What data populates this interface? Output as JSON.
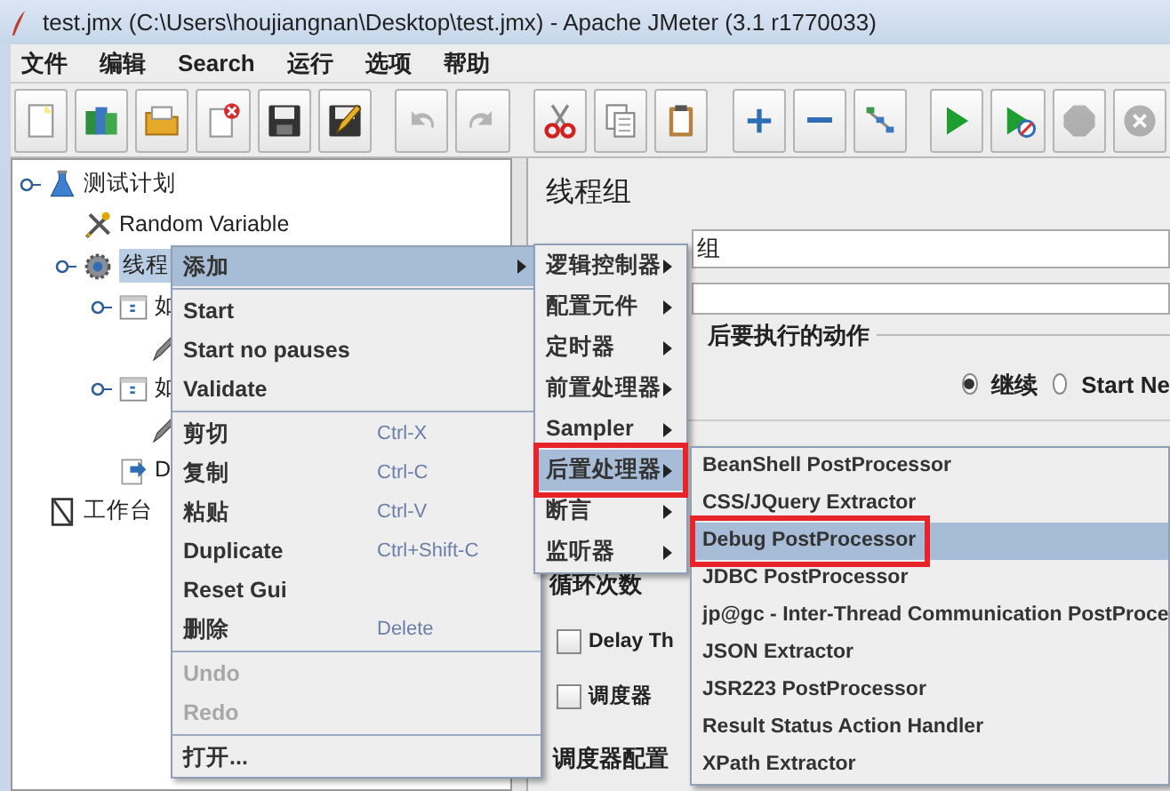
{
  "window": {
    "title": "test.jmx (C:\\Users\\houjiangnan\\Desktop\\test.jmx) - Apache JMeter (3.1 r1770033)"
  },
  "menubar": [
    "文件",
    "编辑",
    "Search",
    "运行",
    "选项",
    "帮助"
  ],
  "toolbar": [
    {
      "kind": "new",
      "disabled": false
    },
    {
      "kind": "templates",
      "disabled": false
    },
    {
      "kind": "open",
      "disabled": false
    },
    {
      "kind": "close",
      "disabled": false
    },
    {
      "kind": "save",
      "disabled": false
    },
    {
      "kind": "saveas",
      "disabled": false
    },
    {
      "kind": "gap"
    },
    {
      "kind": "undo",
      "disabled": true
    },
    {
      "kind": "redo",
      "disabled": true
    },
    {
      "kind": "gap"
    },
    {
      "kind": "cut",
      "disabled": false
    },
    {
      "kind": "copy",
      "disabled": false
    },
    {
      "kind": "paste",
      "disabled": false
    },
    {
      "kind": "gap"
    },
    {
      "kind": "expand",
      "disabled": false
    },
    {
      "kind": "collapse",
      "disabled": false
    },
    {
      "kind": "toggle",
      "disabled": false
    },
    {
      "kind": "gap"
    },
    {
      "kind": "start",
      "disabled": false
    },
    {
      "kind": "startnp",
      "disabled": false
    },
    {
      "kind": "stop",
      "disabled": true
    },
    {
      "kind": "shutdown",
      "disabled": true
    }
  ],
  "tree": [
    {
      "label": "测试计划",
      "kind": "plan",
      "selected": false,
      "expanded": true,
      "children": [
        {
          "label": "Random Variable",
          "kind": "config",
          "selected": false
        },
        {
          "label": "线程",
          "kind": "threadgroup",
          "selected": true,
          "expanded": true,
          "children": [
            {
              "label": "如",
              "kind": "controller",
              "selected": false,
              "expanded": true,
              "children": [
                {
                  "kind": "sampler",
                  "selected": false
                }
              ]
            },
            {
              "label": "如",
              "kind": "controller",
              "selected": false,
              "expanded": true,
              "children": [
                {
                  "kind": "sampler",
                  "selected": false
                }
              ]
            },
            {
              "label": "D",
              "kind": "debug",
              "selected": false
            }
          ]
        }
      ]
    },
    {
      "label": "工作台",
      "kind": "workbench",
      "selected": false
    }
  ],
  "panel": {
    "title": "线程组",
    "name_value": "组",
    "group_legend": "后要执行的动作",
    "radios": [
      {
        "label": "继续",
        "selected": true
      },
      {
        "label": "Start Ne",
        "selected": false
      }
    ],
    "loop_label": "循环次数",
    "checkboxes": [
      {
        "label": "Delay Th",
        "checked": false
      },
      {
        "label": "调度器",
        "checked": false
      }
    ],
    "scheduler_legend": "调度器配置"
  },
  "context_menu": {
    "items": [
      {
        "kind": "item",
        "label": "添加",
        "submenu": true,
        "selected": true,
        "disabled": false
      },
      {
        "kind": "separator"
      },
      {
        "kind": "item",
        "label": "Start",
        "submenu": false,
        "selected": false,
        "disabled": false
      },
      {
        "kind": "item",
        "label": "Start no pauses",
        "submenu": false,
        "selected": false,
        "disabled": false
      },
      {
        "kind": "item",
        "label": "Validate",
        "submenu": false,
        "selected": false,
        "disabled": false
      },
      {
        "kind": "separator"
      },
      {
        "kind": "item",
        "label": "剪切",
        "shortcut": "Ctrl-X",
        "submenu": false,
        "selected": false,
        "disabled": false
      },
      {
        "kind": "item",
        "label": "复制",
        "shortcut": "Ctrl-C",
        "submenu": false,
        "selected": false,
        "disabled": false
      },
      {
        "kind": "item",
        "label": "粘贴",
        "shortcut": "Ctrl-V",
        "submenu": false,
        "selected": false,
        "disabled": false
      },
      {
        "kind": "item",
        "label": "Duplicate",
        "shortcut": "Ctrl+Shift-C",
        "submenu": false,
        "selected": false,
        "disabled": false
      },
      {
        "kind": "item",
        "label": "Reset Gui",
        "submenu": false,
        "selected": false,
        "disabled": false
      },
      {
        "kind": "item",
        "label": "删除",
        "shortcut": "Delete",
        "submenu": false,
        "selected": false,
        "disabled": false
      },
      {
        "kind": "separator"
      },
      {
        "kind": "item",
        "label": "Undo",
        "submenu": false,
        "selected": false,
        "disabled": true
      },
      {
        "kind": "item",
        "label": "Redo",
        "submenu": false,
        "selected": false,
        "disabled": true
      },
      {
        "kind": "separator"
      },
      {
        "kind": "item",
        "label": "打开...",
        "submenu": false,
        "selected": false,
        "disabled": false
      }
    ]
  },
  "add_submenu": {
    "items": [
      {
        "label": "逻辑控制器",
        "selected": false,
        "highlighted": false
      },
      {
        "label": "配置元件",
        "selected": false,
        "highlighted": false
      },
      {
        "label": "定时器",
        "selected": false,
        "highlighted": false
      },
      {
        "label": "前置处理器",
        "selected": false,
        "highlighted": false
      },
      {
        "label": "Sampler",
        "selected": false,
        "highlighted": false
      },
      {
        "label": "后置处理器",
        "selected": true,
        "highlighted": true
      },
      {
        "label": "断言",
        "selected": false,
        "highlighted": false
      },
      {
        "label": "监听器",
        "selected": false,
        "highlighted": false
      }
    ]
  },
  "postprocessor_submenu": {
    "items": [
      {
        "label": "BeanShell PostProcessor",
        "selected": false,
        "highlighted": false
      },
      {
        "label": "CSS/JQuery Extractor",
        "selected": false,
        "highlighted": false
      },
      {
        "label": "Debug PostProcessor",
        "selected": true,
        "highlighted": true
      },
      {
        "label": "JDBC PostProcessor",
        "selected": false,
        "highlighted": false
      },
      {
        "label": "jp@gc - Inter-Thread Communication PostProce",
        "selected": false,
        "highlighted": false
      },
      {
        "label": "JSON Extractor",
        "selected": false,
        "highlighted": false
      },
      {
        "label": "JSR223 PostProcessor",
        "selected": false,
        "highlighted": false
      },
      {
        "label": "Result Status Action Handler",
        "selected": false,
        "highlighted": false
      },
      {
        "label": "XPath Extractor",
        "selected": false,
        "highlighted": false
      }
    ]
  }
}
